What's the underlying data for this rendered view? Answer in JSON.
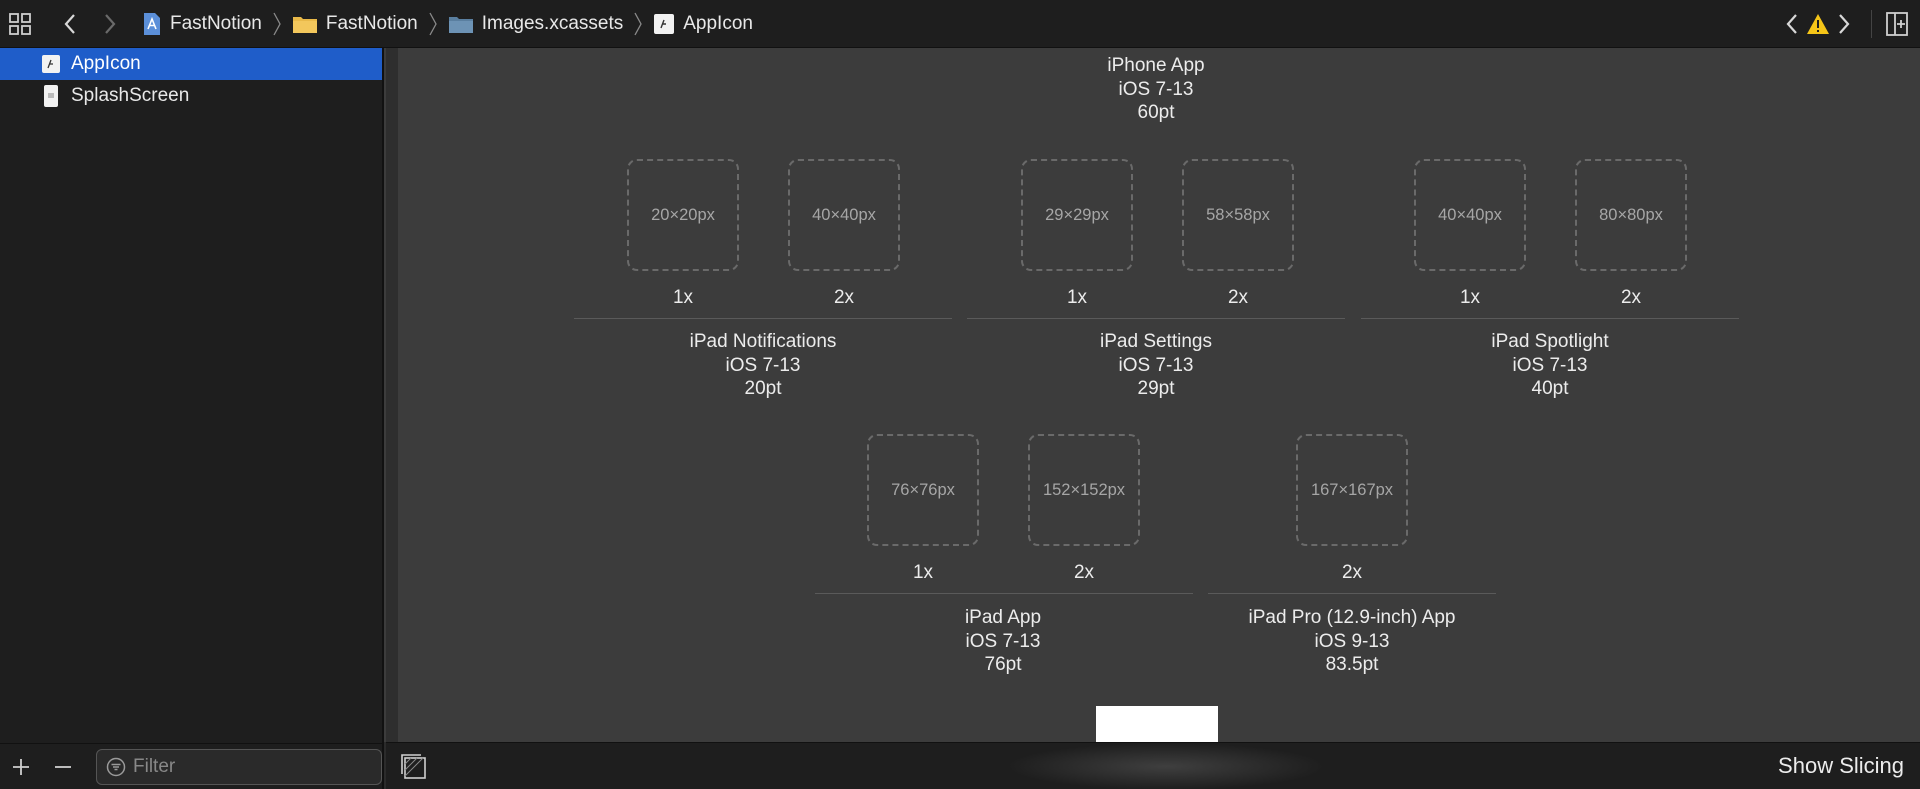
{
  "topbar": {
    "breadcrumbs": [
      {
        "label": "FastNotion",
        "icon": "xcode-project-icon"
      },
      {
        "label": "FastNotion",
        "icon": "folder-icon"
      },
      {
        "label": "Images.xcassets",
        "icon": "asset-catalog-icon"
      },
      {
        "label": "AppIcon",
        "icon": "app-icon-set-icon"
      }
    ]
  },
  "sidebar": {
    "items": [
      {
        "label": "AppIcon",
        "selected": true
      },
      {
        "label": "SplashScreen",
        "selected": false
      }
    ],
    "filter_placeholder": "Filter"
  },
  "editor": {
    "top_group": {
      "name": "iPhone App",
      "ios": "iOS 7-13",
      "size": "60pt"
    },
    "row1": [
      {
        "name": "iPad Notifications",
        "ios": "iOS 7-13",
        "size": "20pt",
        "slots": [
          {
            "px": "20×20px",
            "scale": "1x"
          },
          {
            "px": "40×40px",
            "scale": "2x"
          }
        ]
      },
      {
        "name": "iPad Settings",
        "ios": "iOS 7-13",
        "size": "29pt",
        "slots": [
          {
            "px": "29×29px",
            "scale": "1x"
          },
          {
            "px": "58×58px",
            "scale": "2x"
          }
        ]
      },
      {
        "name": "iPad Spotlight",
        "ios": "iOS 7-13",
        "size": "40pt",
        "slots": [
          {
            "px": "40×40px",
            "scale": "1x"
          },
          {
            "px": "80×80px",
            "scale": "2x"
          }
        ]
      }
    ],
    "row2": [
      {
        "name": "iPad App",
        "ios": "iOS 7-13",
        "size": "76pt",
        "slots": [
          {
            "px": "76×76px",
            "scale": "1x"
          },
          {
            "px": "152×152px",
            "scale": "2x"
          }
        ]
      },
      {
        "name": "iPad Pro (12.9-inch) App",
        "ios": "iOS 9-13",
        "size": "83.5pt",
        "slots": [
          {
            "px": "167×167px",
            "scale": "2x"
          }
        ]
      }
    ]
  },
  "bottombar": {
    "show_slicing": "Show Slicing"
  },
  "colors": {
    "selection": "#1f5dc9",
    "warning": "#f5c518",
    "folder": "#e9b949"
  }
}
